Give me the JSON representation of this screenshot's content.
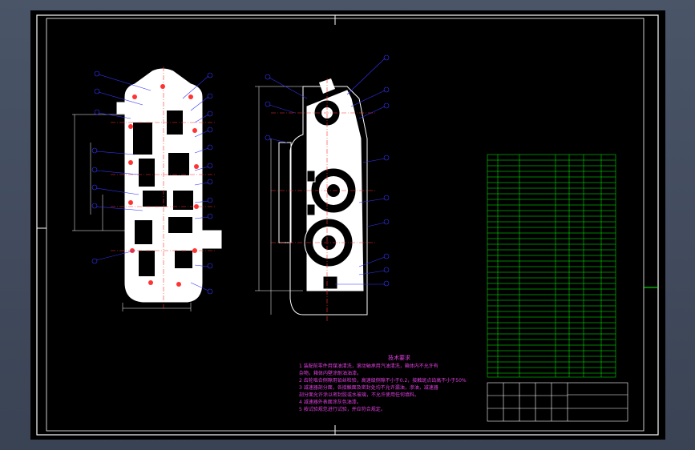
{
  "colors": {
    "background": "#3d4657",
    "sheet": "#000000",
    "frame": "#ffffff",
    "outline": "#ffffff",
    "dimension": "#ffffff",
    "leader": "#3030ff",
    "center_line": "#ff3030",
    "notes": "#e040e0",
    "table": "#00ff00"
  },
  "technical_notes": {
    "title": "技术要求",
    "lines": [
      "1 装配前零件用煤油清洗，滚动轴承用汽油清洗，箱体内不允许有",
      "   杂物，箱体内壁涂耐油油漆。",
      "2 齿轮啮合侧隙用铅丝检验，高速级侧隙不小于0.2，接触斑点齿高不小于50%",
      "3 减速器剖分面，各接触面及密封处均不允许漏油，渗油，减速器",
      "   剖分面允许涂以密封胶或水玻璃，不允许使用任何填料。",
      "4 减速器外表面涂灰色油漆。",
      "5 按试验规范进行试验，并应符合规定。"
    ]
  }
}
